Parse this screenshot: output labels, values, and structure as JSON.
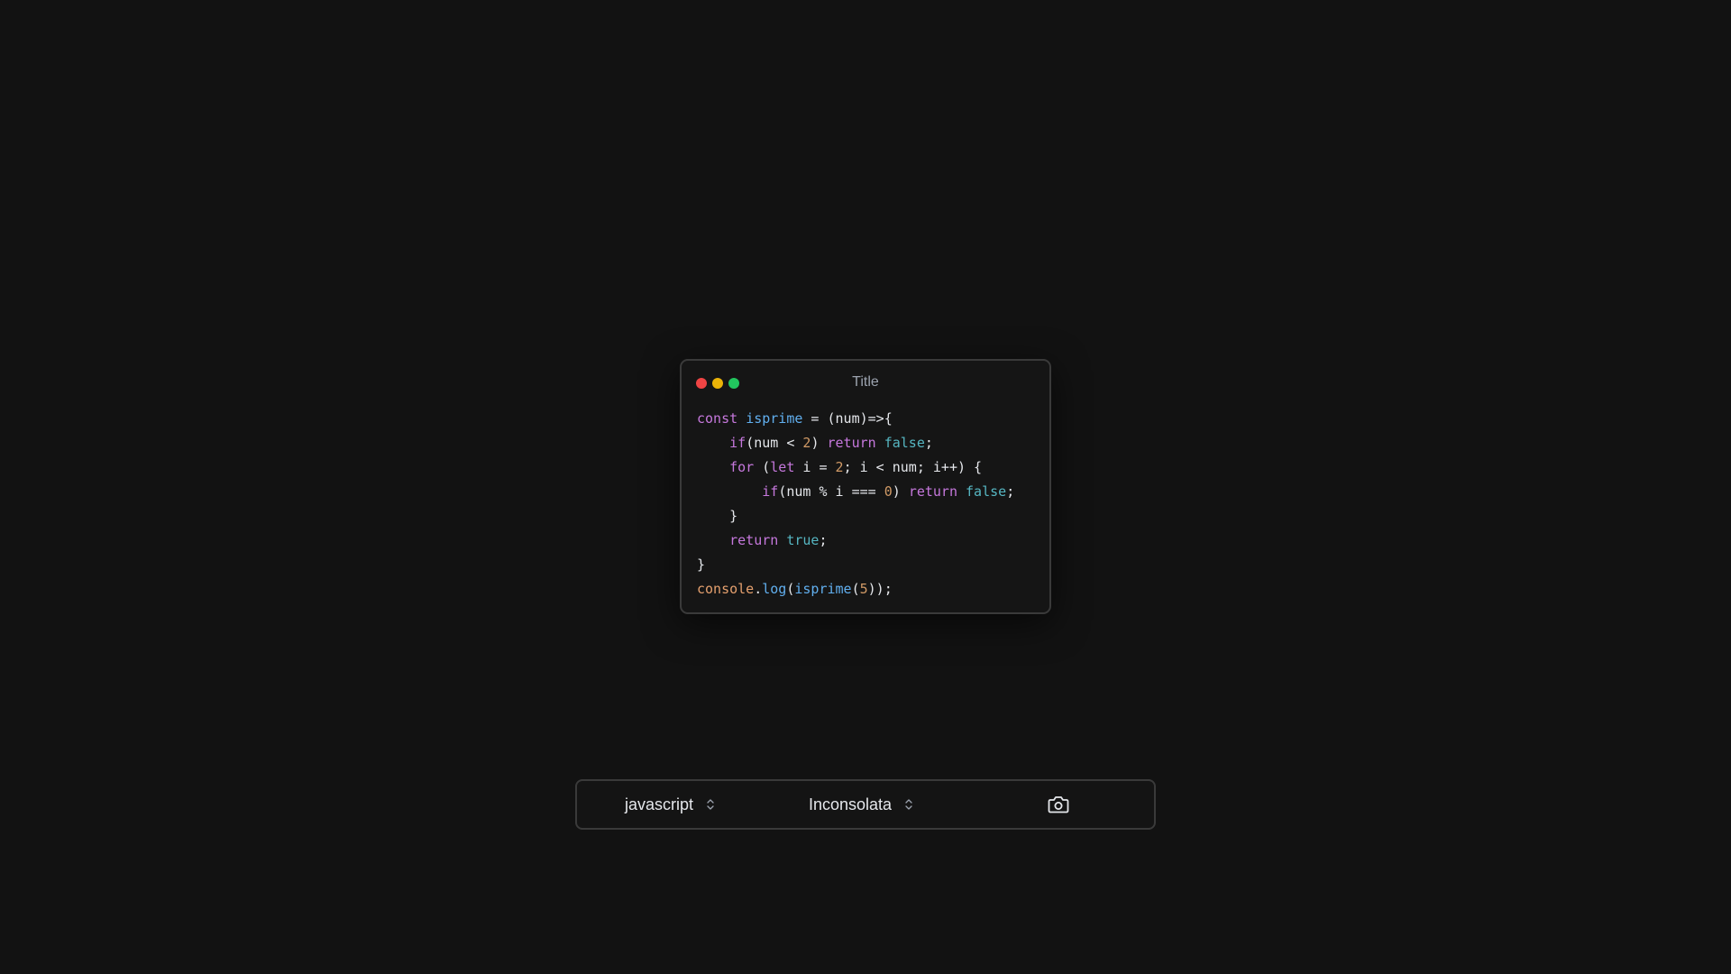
{
  "window": {
    "title": "Title",
    "traffic_lights": {
      "red": "#ef4444",
      "yellow": "#eab308",
      "green": "#22c55e"
    }
  },
  "code": {
    "language": "javascript",
    "lines": [
      [
        {
          "t": "kw",
          "v": "const "
        },
        {
          "t": "fn",
          "v": "isprime"
        },
        {
          "t": "plain",
          "v": " = (num)=>{"
        }
      ],
      [
        {
          "t": "plain",
          "v": "    "
        },
        {
          "t": "kw",
          "v": "if"
        },
        {
          "t": "plain",
          "v": "(num < "
        },
        {
          "t": "num",
          "v": "2"
        },
        {
          "t": "plain",
          "v": ") "
        },
        {
          "t": "kw",
          "v": "return "
        },
        {
          "t": "bool",
          "v": "false"
        },
        {
          "t": "plain",
          "v": ";"
        }
      ],
      [
        {
          "t": "plain",
          "v": "    "
        },
        {
          "t": "kw",
          "v": "for"
        },
        {
          "t": "plain",
          "v": " ("
        },
        {
          "t": "kw",
          "v": "let"
        },
        {
          "t": "plain",
          "v": " i = "
        },
        {
          "t": "num",
          "v": "2"
        },
        {
          "t": "plain",
          "v": "; i < num; i++) {"
        }
      ],
      [
        {
          "t": "plain",
          "v": "        "
        },
        {
          "t": "kw",
          "v": "if"
        },
        {
          "t": "plain",
          "v": "(num % i === "
        },
        {
          "t": "num",
          "v": "0"
        },
        {
          "t": "plain",
          "v": ") "
        },
        {
          "t": "kw",
          "v": "return "
        },
        {
          "t": "bool",
          "v": "false"
        },
        {
          "t": "plain",
          "v": ";"
        }
      ],
      [
        {
          "t": "plain",
          "v": "    }"
        }
      ],
      [
        {
          "t": "plain",
          "v": "    "
        },
        {
          "t": "kw",
          "v": "return "
        },
        {
          "t": "bool",
          "v": "true"
        },
        {
          "t": "plain",
          "v": ";"
        }
      ],
      [
        {
          "t": "plain",
          "v": "}"
        }
      ],
      [
        {
          "t": "obj",
          "v": "console"
        },
        {
          "t": "plain",
          "v": "."
        },
        {
          "t": "fn",
          "v": "log"
        },
        {
          "t": "plain",
          "v": "("
        },
        {
          "t": "fn",
          "v": "isprime"
        },
        {
          "t": "plain",
          "v": "("
        },
        {
          "t": "num",
          "v": "5"
        },
        {
          "t": "plain",
          "v": "));"
        }
      ]
    ]
  },
  "toolbar": {
    "language_select": {
      "value": "javascript"
    },
    "font_select": {
      "value": "Inconsolata"
    },
    "export_button": {
      "icon": "camera-icon"
    }
  },
  "colors": {
    "background": "#121212",
    "keyword": "#c678dd",
    "function": "#61afef",
    "number": "#d19a66",
    "boolean": "#56b6c2",
    "object": "#e5a06e"
  }
}
